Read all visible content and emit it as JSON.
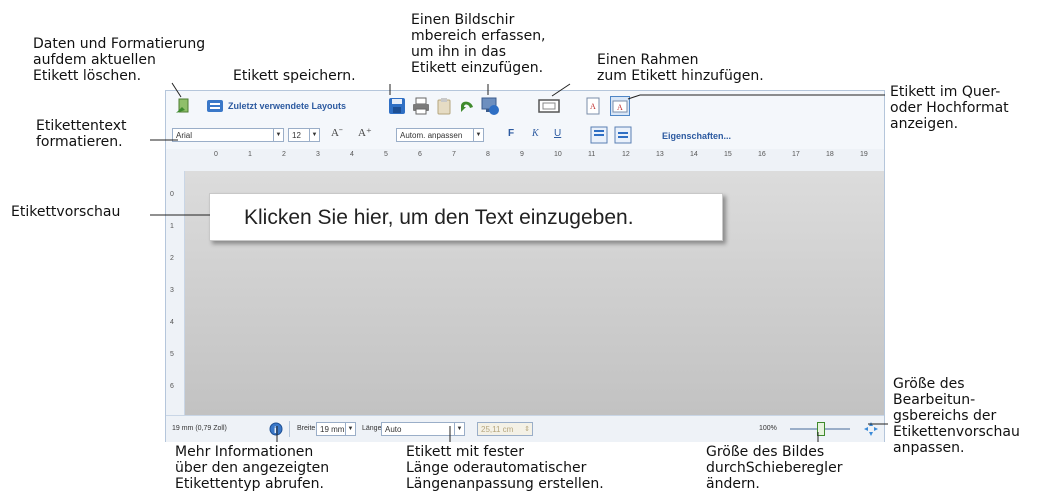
{
  "callouts": {
    "clear": "Daten und Formatierung\naufdem aktuellen\nEtikett löschen.",
    "save": "Etikett speichern.",
    "screenshot": "Einen Bildschir\nmbereich erfassen,\num ihn in das\nEtikett einzufügen.",
    "frame": "Einen Rahmen\nzum Etikett hinzufügen.",
    "orientation": "Etikett im Quer-\noder Hochformat\nanzeigen.",
    "format_text": "Etikettentext\nformatieren.",
    "preview": "Etikettvorschau",
    "edit_area_size": "Größe des\nBearbeitun-\ngsbereichs der\nEtikettenvorschau\nanpassen.",
    "info": "Mehr Informationen\nüber den angezeigten\nEtikettentyp abrufen.",
    "length": "Etikett mit fester\nLänge oderautomatischer\nLängenanpassung erstellen.",
    "zoom": "Größe des Bildes\ndurchSchieberegler\nändern."
  },
  "toolbar": {
    "recent_layouts": "Zuletzt verwendete Layouts",
    "font": "Arial",
    "font_size": "12",
    "autofit": "Autom. anpassen",
    "bold": "F",
    "italic": "K",
    "underline": "U",
    "properties": "Eigenschaften..."
  },
  "ruler": {
    "top": [
      "0",
      "1",
      "2",
      "3",
      "4",
      "5",
      "6",
      "7",
      "8",
      "9",
      "10",
      "11",
      "12",
      "13",
      "14",
      "15",
      "16",
      "17",
      "18",
      "19"
    ],
    "left": [
      "0",
      "1",
      "2",
      "3",
      "4",
      "5",
      "6"
    ]
  },
  "label": {
    "text": "Klicken Sie hier, um den Text einzugeben."
  },
  "status": {
    "size": "19 mm (0,79 Zoll)",
    "width_label": "Breite",
    "width_value": "19 mm",
    "length_label": "Länge",
    "length_value": "Auto",
    "length_cm": "25,11 cm",
    "zoom": "100%",
    "zoom_level": 0.5
  },
  "colors": {
    "accent": "#2c5aa0",
    "border": "#b5c6db",
    "canvas": "#cfcfcf"
  }
}
